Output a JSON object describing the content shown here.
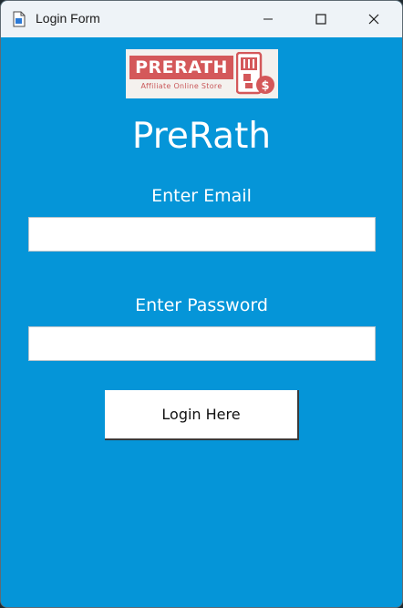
{
  "window": {
    "title": "Login Form",
    "controls": {
      "minimize": "minimize",
      "maximize": "maximize",
      "close": "close"
    }
  },
  "logo": {
    "wordmark": "PRERATH",
    "tagline": "Affiliate Online Store"
  },
  "form": {
    "brand_name": "PreRath",
    "email_label": "Enter Email",
    "email_value": "",
    "password_label": "Enter Password",
    "password_value": "",
    "login_button": "Login Here"
  },
  "colors": {
    "background": "#0595d8",
    "titlebar": "#eef3f7",
    "logo_red": "#d4585a"
  }
}
